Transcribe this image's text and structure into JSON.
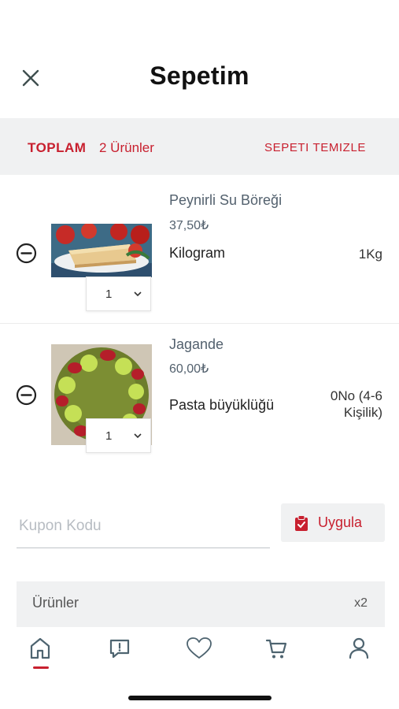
{
  "header": {
    "title": "Sepetim",
    "close_icon": "close-icon"
  },
  "summary": {
    "total_label": "TOPLAM",
    "count": "2 Ürünler",
    "clear_label": "SEPETI TEMIZLE"
  },
  "items": [
    {
      "name": "Peynirli Su Böreği",
      "price": "37,50₺",
      "option_label": "Kilogram",
      "option_value": "1Kg",
      "quantity": "1"
    },
    {
      "name": "Jagande",
      "price": "60,00₺",
      "option_label": "Pasta büyüklüğü",
      "option_value": "0No (4-6 Kişilik)",
      "quantity": "1"
    }
  ],
  "coupon": {
    "placeholder": "Kupon Kodu",
    "apply_label": "Uygula"
  },
  "totals": {
    "products_label": "Ürünler",
    "products_value": "x2"
  },
  "tabbar": {
    "items": [
      "home-icon",
      "message-icon",
      "heart-icon",
      "cart-icon",
      "user-icon"
    ],
    "active": "home-icon"
  },
  "colors": {
    "accent": "#c8202f",
    "muted_text": "#53616e",
    "panel_bg": "#f0f1f2"
  }
}
